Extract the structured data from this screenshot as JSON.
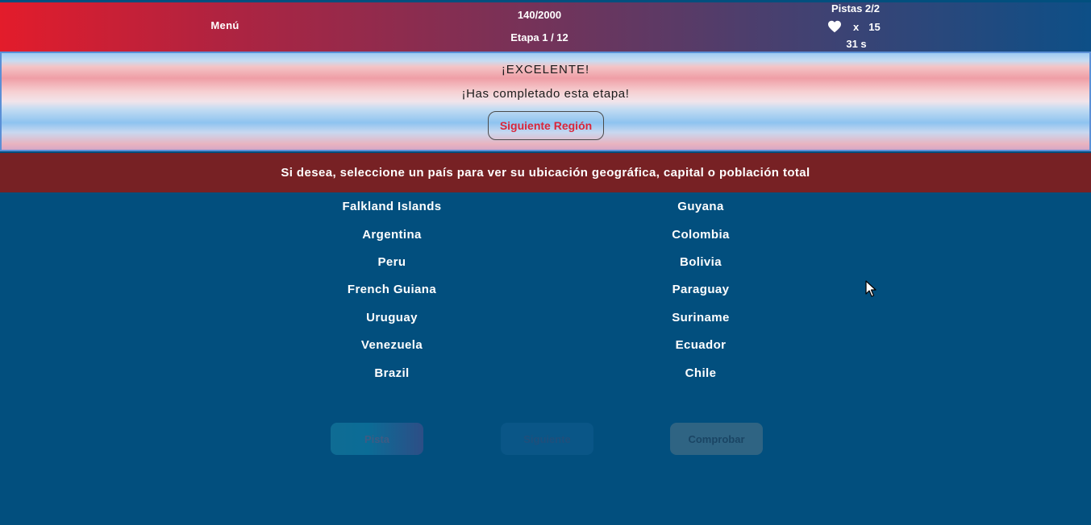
{
  "header": {
    "menu_label": "Menú",
    "score": "140/2000",
    "stage": "Etapa 1 / 12",
    "hints": "Pistas 2/2",
    "lives_multiplier": "x",
    "lives_count": "15",
    "timer": "31 s"
  },
  "banner": {
    "title": "¡EXCELENTE!",
    "subtitle": "¡Has completado esta etapa!",
    "next_region_label": "Siguiente Región"
  },
  "instruction": "Si desea, seleccione un país para ver su ubicación geográfica, capital o población total",
  "countries": {
    "left": [
      "Falkland Islands",
      "Argentina",
      "Peru",
      "French Guiana",
      "Uruguay",
      "Venezuela",
      "Brazil"
    ],
    "right": [
      "Guyana",
      "Colombia",
      "Bolivia",
      "Paraguay",
      "Suriname",
      "Ecuador",
      "Chile"
    ]
  },
  "buttons": {
    "hint": "Pista",
    "next": "Siguiente",
    "check": "Comprobar"
  },
  "colors": {
    "background": "#024f7e",
    "instruction_bar": "#772124",
    "accent_red": "#d9263a"
  },
  "icons": [
    "heart-icon",
    "mouse-cursor-icon"
  ]
}
